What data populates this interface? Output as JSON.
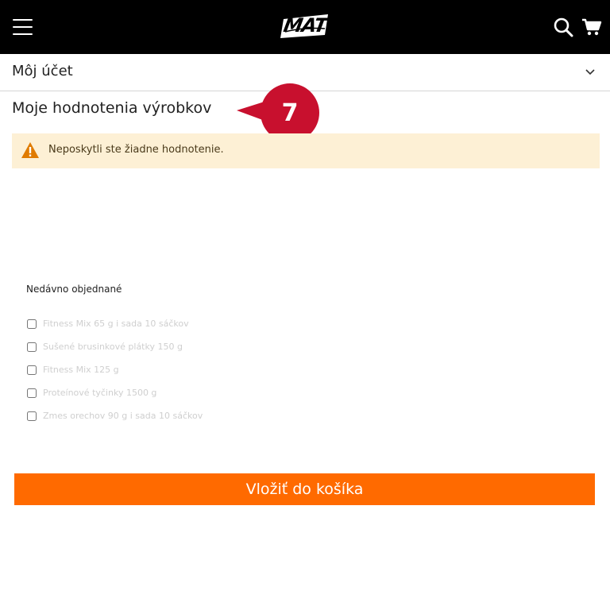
{
  "header": {
    "logo_text": "MAT",
    "background_color": "#000000"
  },
  "account": {
    "label": "Môj účet"
  },
  "reviews": {
    "title": "Moje hodnotenia výrobkov",
    "callout_number": "7",
    "callout_color": "#c8102e",
    "notice_text": "Neposkytli ste žiadne hodnotenie.",
    "notice_background": "#fdf0d5",
    "warning_color": "#e07b00"
  },
  "recent": {
    "title": "Nedávno objednané",
    "items": [
      {
        "name": "Fitness Mix 65 g i sada 10 sáčkov",
        "checked": false
      },
      {
        "name": "Sušené brusinkové plátky 150 g",
        "checked": false
      },
      {
        "name": "Fitness Mix 125 g",
        "checked": false
      },
      {
        "name": "Proteínové tyčinky 1500 g",
        "checked": false
      },
      {
        "name": "Zmes orechov 90 g i sada 10 sáčkov",
        "checked": false
      }
    ]
  },
  "cart_button": {
    "label": "Vložiť do košíka",
    "color": "#ff6a00"
  }
}
